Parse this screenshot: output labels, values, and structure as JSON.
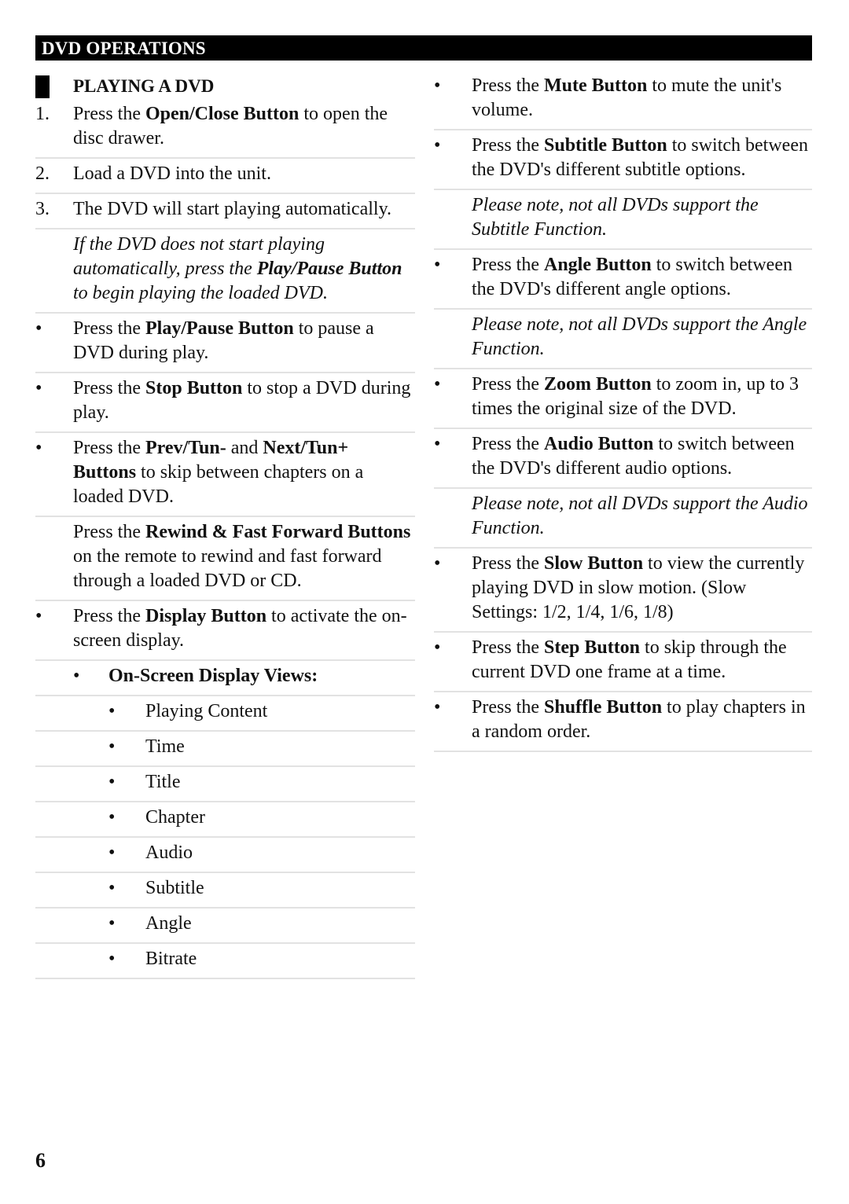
{
  "header": {
    "title": "DVD OPERATIONS"
  },
  "section": {
    "title": "PLAYING A DVD"
  },
  "left_items": [
    {
      "type": "numbered",
      "marker": "1.",
      "parts": [
        {
          "t": "Press the "
        },
        {
          "t": "Open/Close Button",
          "b": true
        },
        {
          "t": " to open the disc drawer."
        }
      ]
    },
    {
      "type": "numbered",
      "marker": "2.",
      "parts": [
        {
          "t": "Load a DVD into the unit."
        }
      ]
    },
    {
      "type": "numbered",
      "marker": "3.",
      "parts": [
        {
          "t": "The DVD will start playing automatically."
        }
      ]
    },
    {
      "type": "note",
      "marker": "",
      "parts": [
        {
          "t": "If the DVD does not start playing automatically, press the "
        },
        {
          "t": "Play/Pause Button",
          "b": true
        },
        {
          "t": " to begin playing the loaded DVD."
        }
      ]
    },
    {
      "type": "bullet",
      "marker": "•",
      "parts": [
        {
          "t": "Press the "
        },
        {
          "t": "Play/Pause Button",
          "b": true
        },
        {
          "t": " to pause a DVD during play."
        }
      ]
    },
    {
      "type": "bullet",
      "marker": "•",
      "parts": [
        {
          "t": "Press the "
        },
        {
          "t": "Stop Button",
          "b": true
        },
        {
          "t": " to stop a DVD during play."
        }
      ]
    },
    {
      "type": "bullet",
      "marker": "•",
      "parts": [
        {
          "t": "Press the "
        },
        {
          "t": "Prev/Tun-",
          "b": true
        },
        {
          "t": " and "
        },
        {
          "t": "Next/Tun+ Buttons",
          "b": true
        },
        {
          "t": " to skip between chapters on a loaded DVD."
        }
      ]
    },
    {
      "type": "plain",
      "marker": "",
      "parts": [
        {
          "t": "Press the "
        },
        {
          "t": "Rewind & Fast Forward Buttons",
          "b": true
        },
        {
          "t": " on the remote to rewind and fast forward through a loaded DVD or CD."
        }
      ]
    },
    {
      "type": "bullet",
      "marker": "•",
      "parts": [
        {
          "t": "Press the "
        },
        {
          "t": "Display Button",
          "b": true
        },
        {
          "t": " to activate the on-screen display."
        }
      ]
    },
    {
      "type": "sub",
      "marker": "•",
      "parts": [
        {
          "t": "On-Screen Display Views:"
        }
      ]
    },
    {
      "type": "subsub",
      "marker": "•",
      "parts": [
        {
          "t": "Playing Content"
        }
      ]
    },
    {
      "type": "subsub",
      "marker": "•",
      "parts": [
        {
          "t": "Time"
        }
      ]
    },
    {
      "type": "subsub",
      "marker": "•",
      "parts": [
        {
          "t": "Title"
        }
      ]
    },
    {
      "type": "subsub",
      "marker": "•",
      "parts": [
        {
          "t": "Chapter"
        }
      ]
    },
    {
      "type": "subsub",
      "marker": "•",
      "parts": [
        {
          "t": "Audio"
        }
      ]
    },
    {
      "type": "subsub",
      "marker": "•",
      "parts": [
        {
          "t": "Subtitle"
        }
      ]
    },
    {
      "type": "subsub",
      "marker": "•",
      "parts": [
        {
          "t": "Angle"
        }
      ]
    },
    {
      "type": "subsub",
      "marker": "•",
      "parts": [
        {
          "t": "Bitrate"
        }
      ]
    }
  ],
  "right_items": [
    {
      "type": "bullet",
      "marker": "•",
      "parts": [
        {
          "t": "Press the "
        },
        {
          "t": "Mute Button",
          "b": true
        },
        {
          "t": " to mute the unit's volume."
        }
      ]
    },
    {
      "type": "bullet",
      "marker": "•",
      "parts": [
        {
          "t": "Press the "
        },
        {
          "t": "Subtitle Button",
          "b": true
        },
        {
          "t": " to switch between the DVD's different subtitle options."
        }
      ]
    },
    {
      "type": "note",
      "marker": "",
      "parts": [
        {
          "t": "Please note, not all DVDs support the Subtitle Function."
        }
      ]
    },
    {
      "type": "bullet",
      "marker": "•",
      "parts": [
        {
          "t": "Press the "
        },
        {
          "t": "Angle Button",
          "b": true
        },
        {
          "t": " to switch between the DVD's different angle options."
        }
      ]
    },
    {
      "type": "note",
      "marker": "",
      "parts": [
        {
          "t": "Please note, not all DVDs support the Angle Function."
        }
      ]
    },
    {
      "type": "bullet",
      "marker": "•",
      "parts": [
        {
          "t": "Press the "
        },
        {
          "t": "Zoom Button",
          "b": true
        },
        {
          "t": " to zoom in, up to 3 times the original size of the DVD."
        }
      ]
    },
    {
      "type": "bullet",
      "marker": "•",
      "parts": [
        {
          "t": "Press the "
        },
        {
          "t": "Audio Button",
          "b": true
        },
        {
          "t": " to switch between the DVD's different audio options."
        }
      ]
    },
    {
      "type": "note",
      "marker": "",
      "parts": [
        {
          "t": "Please note, not all DVDs support the Audio Function."
        }
      ]
    },
    {
      "type": "bullet",
      "marker": "•",
      "parts": [
        {
          "t": "Press the "
        },
        {
          "t": "Slow Button",
          "b": true
        },
        {
          "t": " to view the currently playing DVD in slow motion. (Slow Settings: 1/2, 1/4, 1/6, 1/8)"
        }
      ]
    },
    {
      "type": "bullet",
      "marker": "•",
      "parts": [
        {
          "t": "Press the "
        },
        {
          "t": "Step Button",
          "b": true
        },
        {
          "t": " to skip through the current DVD one frame at a time."
        }
      ]
    },
    {
      "type": "bullet",
      "marker": "•",
      "parts": [
        {
          "t": "Press the "
        },
        {
          "t": "Shuffle Button",
          "b": true
        },
        {
          "t": " to play chapters in a random order."
        }
      ]
    }
  ],
  "footer": {
    "page_number": "6"
  }
}
